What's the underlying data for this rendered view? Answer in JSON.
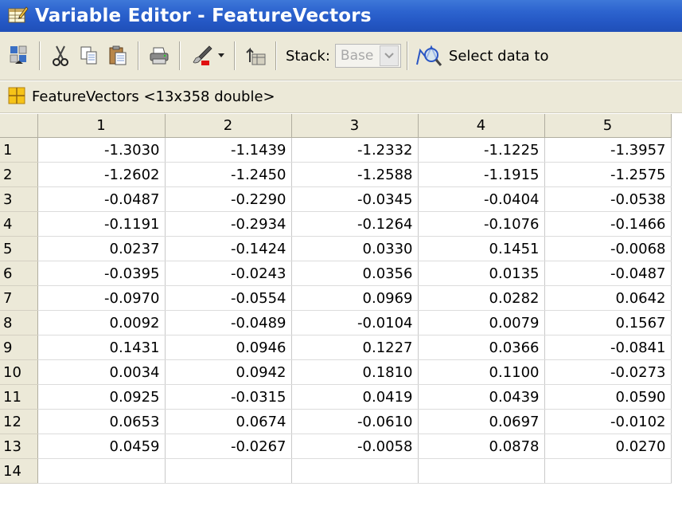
{
  "window": {
    "title": "Variable Editor - FeatureVectors"
  },
  "toolbar": {
    "stack_label": "Stack:",
    "stack_value": "Base",
    "select_data_label": "Select data to"
  },
  "variable": {
    "info": "FeatureVectors <13x358 double>"
  },
  "grid": {
    "columns": [
      "1",
      "2",
      "3",
      "4",
      "5"
    ],
    "row_headers": [
      "1",
      "2",
      "3",
      "4",
      "5",
      "6",
      "7",
      "8",
      "9",
      "10",
      "11",
      "12",
      "13",
      "14"
    ],
    "rows": [
      [
        "-1.3030",
        "-1.1439",
        "-1.2332",
        "-1.1225",
        "-1.3957"
      ],
      [
        "-1.2602",
        "-1.2450",
        "-1.2588",
        "-1.1915",
        "-1.2575"
      ],
      [
        "-0.0487",
        "-0.2290",
        "-0.0345",
        "-0.0404",
        "-0.0538"
      ],
      [
        "-0.1191",
        "-0.2934",
        "-0.1264",
        "-0.1076",
        "-0.1466"
      ],
      [
        "0.0237",
        "-0.1424",
        "0.0330",
        "0.1451",
        "-0.0068"
      ],
      [
        "-0.0395",
        "-0.0243",
        "0.0356",
        "0.0135",
        "-0.0487"
      ],
      [
        "-0.0970",
        "-0.0554",
        "0.0969",
        "0.0282",
        "0.0642"
      ],
      [
        "0.0092",
        "-0.0489",
        "-0.0104",
        "0.0079",
        "0.1567"
      ],
      [
        "0.1431",
        "0.0946",
        "0.1227",
        "0.0366",
        "-0.0841"
      ],
      [
        "0.0034",
        "0.0942",
        "0.1810",
        "0.1100",
        "-0.0273"
      ],
      [
        "0.0925",
        "-0.0315",
        "0.0419",
        "0.0439",
        "0.0590"
      ],
      [
        "0.0653",
        "0.0674",
        "-0.0610",
        "0.0697",
        "-0.0102"
      ],
      [
        "0.0459",
        "-0.0267",
        "-0.0058",
        "0.0878",
        "0.0270"
      ],
      [
        "",
        "",
        "",
        "",
        ""
      ]
    ]
  },
  "icons": {
    "title": "variable-editor-icon",
    "toolbar": [
      "import-data-icon",
      "cut-icon",
      "copy-icon",
      "paste-icon",
      "print-icon",
      "plot-brush-icon",
      "dropdown-arrow-icon",
      "up-level-icon",
      "select-data-icon"
    ],
    "info": "array-grid-icon"
  }
}
